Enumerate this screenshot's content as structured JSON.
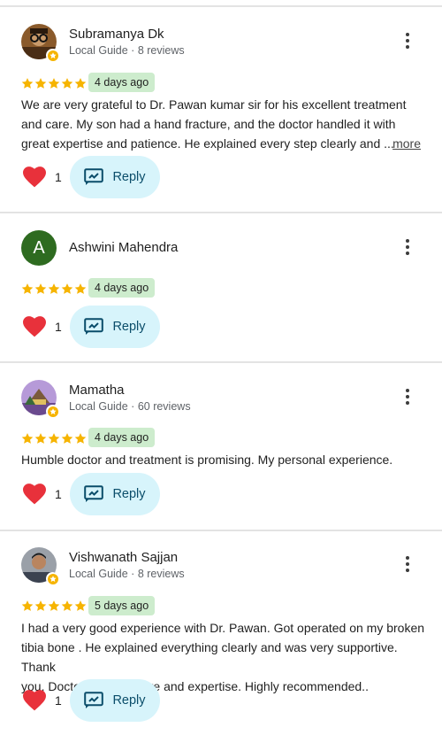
{
  "reviews": [
    {
      "name": "Subramanya Dk",
      "meta": "Local Guide · 8 reviews",
      "date": "4 days ago",
      "text_lines": [
        "We are very grateful to Dr. Pawan kumar  sir for his excellent treatment",
        "and care. My son had a hand fracture, and the doctor handled it with",
        "great expertise and patience. He explained every step clearly and ..."
      ],
      "more": "more",
      "likes": "1",
      "reply": "Reply",
      "stars": 5
    },
    {
      "name": "Ashwini Mahendra",
      "avatar_letter": "A",
      "date": "4 days ago",
      "likes": "1",
      "reply": "Reply",
      "stars": 5
    },
    {
      "name": "Mamatha",
      "meta": "Local Guide · 60 reviews",
      "date": "4 days ago",
      "text_lines": [
        "Humble doctor and treatment is promising. My personal experience."
      ],
      "likes": "1",
      "reply": "Reply",
      "stars": 5
    },
    {
      "name": "Vishwanath Sajjan",
      "meta": "Local Guide · 8 reviews",
      "date": "5 days ago",
      "text_lines": [
        "I had a very good experience with Dr. Pawan. Got operated on my broken",
        "tibia bone . He explained everything clearly and was very supportive. Thank",
        "you, Doctor, for your care and expertise. Highly recommended.."
      ],
      "likes": "1",
      "reply": "Reply",
      "stars": 5
    }
  ],
  "colors": {
    "star": "#f6b400",
    "date_badge_bg": "#cdeccd",
    "reply_bg": "#d7f4fb",
    "heart": "#e8313b",
    "avatar_letter_bg": "#2e6b20"
  },
  "icons": [
    "kebab-menu-icon",
    "heart-icon",
    "reply-icon",
    "star-icon",
    "local-guide-badge-icon"
  ]
}
